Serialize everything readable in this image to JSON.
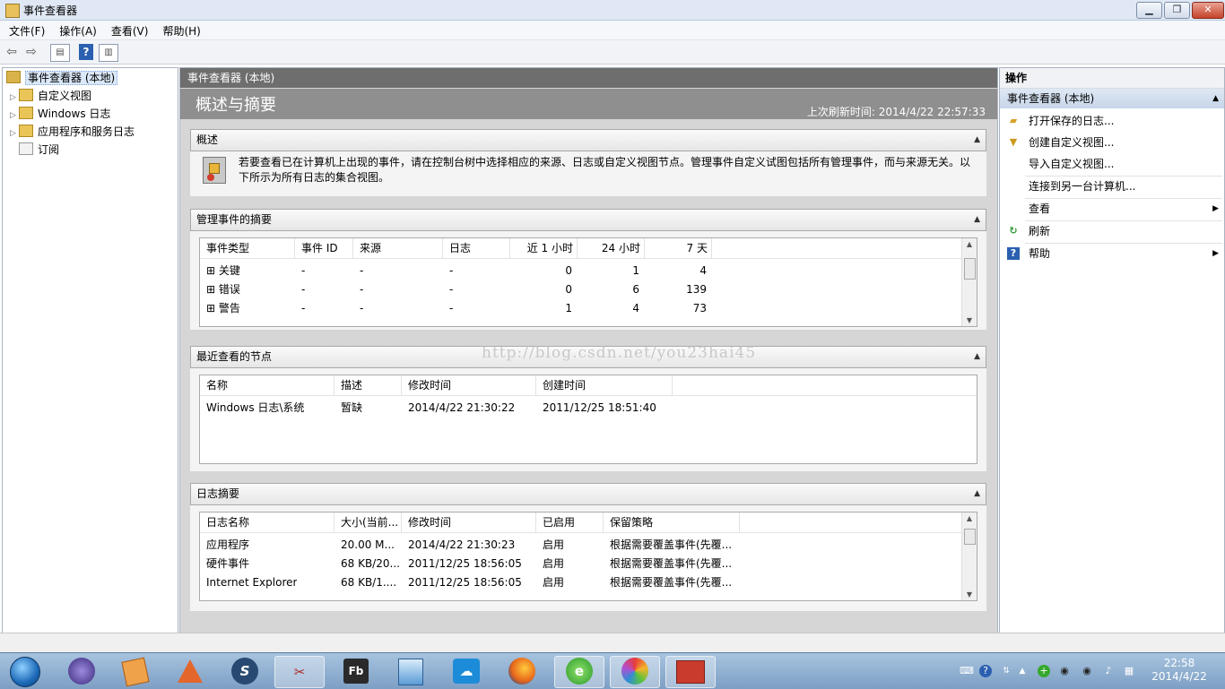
{
  "window": {
    "title": "事件查看器",
    "minimize": "▁",
    "restore": "❐",
    "close": "✕"
  },
  "menu": [
    "文件(F)",
    "操作(A)",
    "查看(V)",
    "帮助(H)"
  ],
  "tree": [
    {
      "label": "事件查看器 (本地)",
      "icon": "event-viewer-icon",
      "selected": true
    },
    {
      "label": "自定义视图",
      "icon": "folder-icon"
    },
    {
      "label": "Windows 日志",
      "icon": "folder-icon"
    },
    {
      "label": "应用程序和服务日志",
      "icon": "folder-icon"
    },
    {
      "label": "订阅",
      "icon": "subscription-icon"
    }
  ],
  "center": {
    "header": "事件查看器 (本地)",
    "title": "概述与摘要",
    "last_refresh": "上次刷新时间: 2014/4/22 22:57:33",
    "overview": {
      "title": "概述",
      "text": "若要查看已在计算机上出现的事件，请在控制台树中选择相应的来源、日志或自定义视图节点。管理事件自定义试图包括所有管理事件，而与来源无关。以下所示为所有日志的集合视图。"
    },
    "admin_summary": {
      "title": "管理事件的摘要",
      "columns": [
        "事件类型",
        "事件 ID",
        "来源",
        "日志",
        "近 1 小时",
        "24 小时",
        "7 天"
      ],
      "rows": [
        [
          "关键",
          "-",
          "-",
          "-",
          "0",
          "1",
          "4"
        ],
        [
          "错误",
          "-",
          "-",
          "-",
          "0",
          "6",
          "139"
        ],
        [
          "警告",
          "-",
          "-",
          "-",
          "1",
          "4",
          "73"
        ]
      ]
    },
    "recent_nodes": {
      "title": "最近查看的节点",
      "columns": [
        "名称",
        "描述",
        "修改时间",
        "创建时间"
      ],
      "rows": [
        [
          "Windows 日志\\系统",
          "暂缺",
          "2014/4/22 21:30:22",
          "2011/12/25 18:51:40"
        ]
      ]
    },
    "log_summary": {
      "title": "日志摘要",
      "columns": [
        "日志名称",
        "大小(当前...",
        "修改时间",
        "已启用",
        "保留策略"
      ],
      "rows": [
        [
          "应用程序",
          "20.00 M...",
          "2014/4/22 21:30:23",
          "启用",
          "根据需要覆盖事件(先覆..."
        ],
        [
          "硬件事件",
          "68 KB/20...",
          "2011/12/25 18:56:05",
          "启用",
          "根据需要覆盖事件(先覆..."
        ],
        [
          "Internet Explorer",
          "68 KB/1....",
          "2011/12/25 18:56:05",
          "启用",
          "根据需要覆盖事件(先覆..."
        ]
      ]
    },
    "watermark": "http://blog.csdn.net/you23hai45"
  },
  "actions": {
    "title": "操作",
    "group": "事件查看器 (本地)",
    "items": [
      {
        "label": "打开保存的日志...",
        "icon": "open-folder-icon"
      },
      {
        "label": "创建自定义视图...",
        "icon": "filter-icon"
      },
      {
        "label": "导入自定义视图...",
        "icon": ""
      },
      {
        "label": "连接到另一台计算机...",
        "icon": ""
      },
      {
        "label": "查看",
        "icon": "",
        "submenu": true
      },
      {
        "label": "刷新",
        "icon": "refresh-icon"
      },
      {
        "label": "帮助",
        "icon": "help-icon",
        "submenu": true
      }
    ]
  },
  "taskbar": {
    "clock_time": "22:58",
    "clock_date": "2014/4/22",
    "apps": [
      "eclipse-icon",
      "paint-icon",
      "matlab-icon",
      "sublime-icon",
      "snipping-tool-icon",
      "flash-builder-icon",
      "virtualbox-icon",
      "cloud-drive-icon",
      "firefox-icon",
      "browser-icon",
      "color-app-icon",
      "toolbox-icon"
    ]
  },
  "colors": {
    "accent": "#5a7fb0",
    "header_dark": "#6e6e6e",
    "banner": "#8f8f8f"
  }
}
